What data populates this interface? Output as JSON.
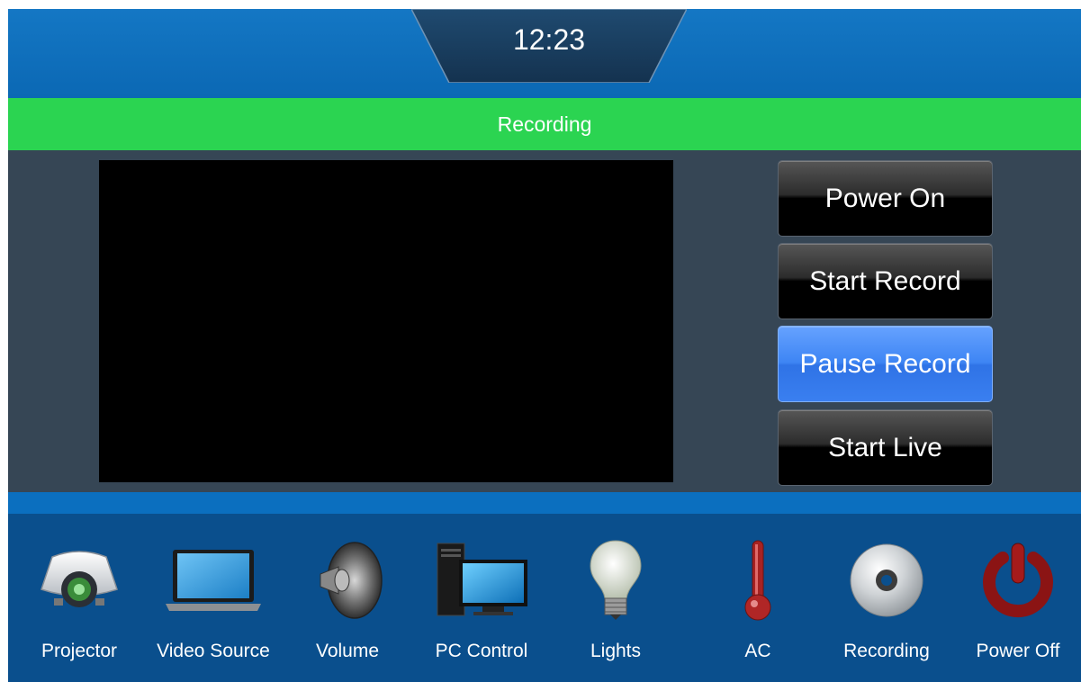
{
  "header": {
    "time": "12:23"
  },
  "status": {
    "title": "Recording"
  },
  "controls": [
    {
      "label": "Power On",
      "active": false
    },
    {
      "label": "Start Record",
      "active": false
    },
    {
      "label": "Pause Record",
      "active": true
    },
    {
      "label": "Start Live",
      "active": false
    }
  ],
  "nav": [
    {
      "label": "Projector",
      "icon": "projector-icon"
    },
    {
      "label": "Video Source",
      "icon": "laptop-icon"
    },
    {
      "label": "Volume",
      "icon": "speaker-icon"
    },
    {
      "label": "PC Control",
      "icon": "pc-icon"
    },
    {
      "label": "Lights",
      "icon": "lightbulb-icon"
    },
    {
      "label": "AC",
      "icon": "thermometer-icon"
    },
    {
      "label": "Recording",
      "icon": "disc-icon"
    },
    {
      "label": "Power Off",
      "icon": "power-icon"
    }
  ],
  "colors": {
    "header": "#0b68b4",
    "status_bar": "#2bd451",
    "main_bg": "#364655",
    "nav_bg": "#0a4f8d",
    "active_button": "#3e85f4"
  }
}
